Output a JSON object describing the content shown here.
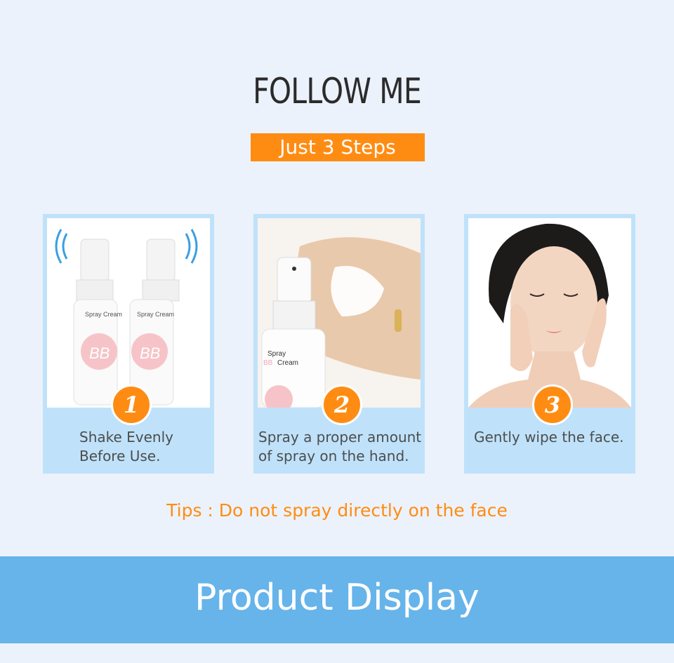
{
  "header": {
    "title": "FOLLOW ME",
    "badge": "Just 3 Steps"
  },
  "steps": [
    {
      "number": "1",
      "caption_line1": "Shake Evenly",
      "caption_line2": "Before Use."
    },
    {
      "number": "2",
      "caption_line1": "Spray a proper amount",
      "caption_line2": "of spray on the hand."
    },
    {
      "number": "3",
      "caption_line1": "Gently wipe the face.",
      "caption_line2": ""
    }
  ],
  "product_label": {
    "line1": "Spray",
    "line2": "Cream",
    "bb": "BB",
    "spray_cream": "Spray Cream"
  },
  "tips": "Tips : Do not spray directly on the face",
  "banner": "Product Display",
  "colors": {
    "accent": "#ff8c12",
    "card": "#bfe2fa",
    "banner": "#66b4ea",
    "background": "#ecf2fb"
  }
}
